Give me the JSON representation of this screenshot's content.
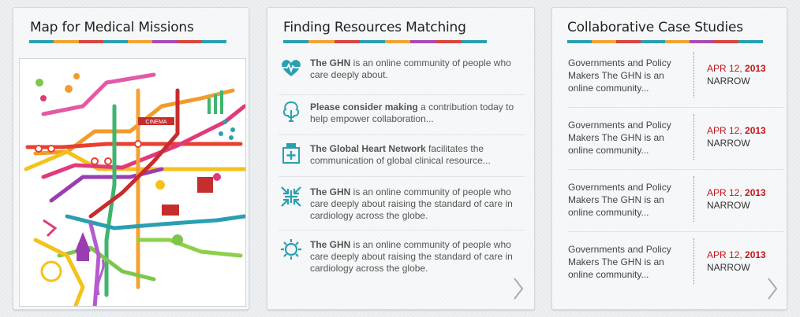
{
  "map_panel": {
    "title": "Map for Medical Missions",
    "map_sign_text": "CINEMA"
  },
  "resources_panel": {
    "title": "Finding Resources Matching",
    "items": [
      {
        "icon": "heart-pulse-icon",
        "bold": "The GHN",
        "rest": " is an online community of people who care deeply about."
      },
      {
        "icon": "tree-icon",
        "bold": "Please consider making",
        "rest": " a contribution today to help empower collaboration..."
      },
      {
        "icon": "medicine-jar-icon",
        "bold": "The Global Heart Network",
        "rest": " facilitates the communication of global clinical resource..."
      },
      {
        "icon": "arrows-in-icon",
        "bold": "The GHN",
        "rest": " is an online community of people who care deeply about raising the standard of care in cardiology across the globe."
      },
      {
        "icon": "sun-icon",
        "bold": "The GHN",
        "rest": " is an online community of people who care deeply about raising the standard of care in cardiology across the globe."
      }
    ]
  },
  "cases_panel": {
    "title": "Collaborative Case Studies",
    "items": [
      {
        "text": "Governments and Policy Makers The GHN is an online community...",
        "date": "APR 12, ",
        "year": "2013",
        "tag": "NARROW"
      },
      {
        "text": "Governments and Policy Makers The GHN is an online community...",
        "date": "APR 12, ",
        "year": "2013",
        "tag": "NARROW"
      },
      {
        "text": "Governments and Policy Makers The GHN is an online community...",
        "date": "APR 12, ",
        "year": "2013",
        "tag": "NARROW"
      },
      {
        "text": "Governments and Policy Makers The GHN is an online community...",
        "date": "APR 12, ",
        "year": "2013",
        "tag": "NARROW"
      }
    ]
  },
  "colors": {
    "accent_teal": "#2a9fb0",
    "date_red": "#c4161c",
    "stripe": [
      "#2a9fb0",
      "#f1a334",
      "#d8463d",
      "#e25aa4",
      "#a84ab5",
      "#7dc64b"
    ]
  }
}
